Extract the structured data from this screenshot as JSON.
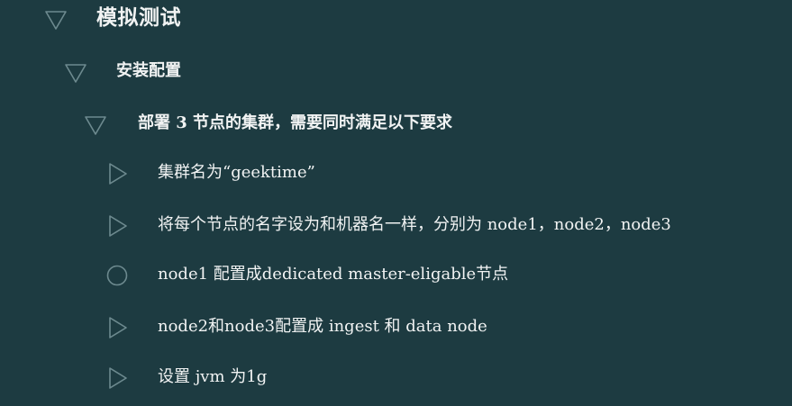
{
  "slide": {
    "title": "模拟测试",
    "section": "安装配置",
    "subsection": "部署 3 节点的集群，需要同时满足以下要求",
    "requirements": [
      {
        "text": "集群名为“geektime”",
        "icon": "triangle-right-icon"
      },
      {
        "text": "将每个节点的名字设为和机器名一样，分别为 node1，node2，node3",
        "icon": "triangle-right-icon"
      },
      {
        "text": "node1 配置成dedicated master-eligable节点",
        "icon": "circle-icon"
      },
      {
        "text": "node2和node3配置成 ingest 和 data node",
        "icon": "triangle-right-icon"
      },
      {
        "text": "设置 jvm 为1g",
        "icon": "triangle-right-icon"
      }
    ]
  },
  "colors": {
    "background": "#1d3b41",
    "text": "#f1f3f3",
    "marker": "#6d8a8f"
  }
}
